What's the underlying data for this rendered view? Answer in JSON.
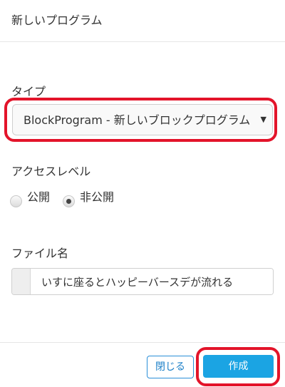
{
  "dialog": {
    "title": "新しいプログラム"
  },
  "type_field": {
    "label": "タイプ",
    "selected": "BlockProgram - 新しいブロックプログラム",
    "arrow": "▼"
  },
  "access_level": {
    "label": "アクセスレベル",
    "options": [
      {
        "label": "公開",
        "checked": false
      },
      {
        "label": "非公開",
        "checked": true
      }
    ]
  },
  "file_name": {
    "label": "ファイル名",
    "value": "いすに座るとハッピーバースデが流れる"
  },
  "footer": {
    "close_label": "閉じる",
    "create_label": "作成"
  },
  "colors": {
    "highlight": "#e3142a",
    "primary": "#1ba4e3",
    "link": "#1d80c8"
  }
}
